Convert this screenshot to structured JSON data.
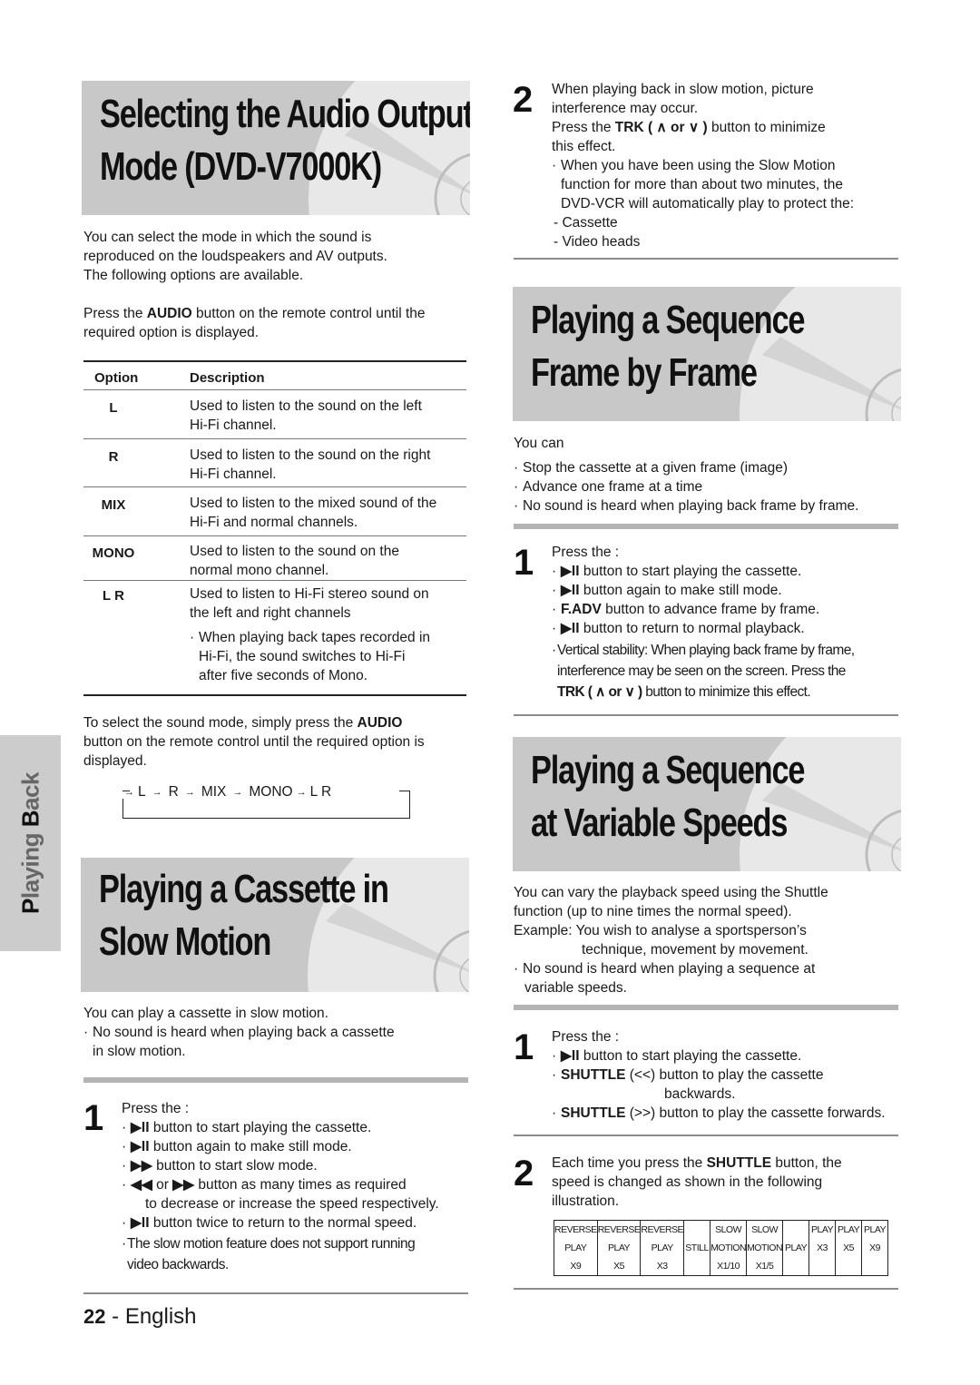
{
  "page": {
    "number": "22",
    "language": "English",
    "side_tab": "Playing Back"
  },
  "audio_output": {
    "title_line1": "Selecting the Audio Output",
    "title_line2": "Mode (DVD-V7000K)",
    "intro_lines": [
      "You can select the mode in which the sound is",
      "reproduced on the loudspeakers and AV outputs.",
      "The following options are available."
    ],
    "press_pre": "Press the ",
    "press_bold": "AUDIO",
    "press_post": " button on the remote control until the",
    "press_line2": "required option is displayed.",
    "table": {
      "header_option": "Option",
      "header_description": "Description",
      "rows": [
        {
          "option": "L",
          "desc": [
            "Used to listen to the sound on the left",
            "Hi-Fi channel."
          ]
        },
        {
          "option": "R",
          "desc": [
            "Used to listen to the sound on the right",
            "Hi-Fi channel."
          ]
        },
        {
          "option": "MIX",
          "desc": [
            "Used to listen to the mixed sound of the",
            "Hi-Fi and normal channels."
          ]
        },
        {
          "option": "MONO",
          "desc": [
            "Used to listen to the sound on the",
            "normal mono channel."
          ]
        },
        {
          "option": "L R",
          "desc": [
            "Used to listen to Hi-Fi stereo sound on",
            "the left and right channels"
          ],
          "note": [
            "When playing back tapes recorded in",
            "Hi-Fi, the sound switches to Hi-Fi",
            "after five seconds of Mono."
          ]
        }
      ]
    },
    "select_pre": "To select the sound mode, simply press the ",
    "select_bold": "AUDIO",
    "select_line2": "button on the remote control until the required option is",
    "select_line3": "displayed.",
    "cycle": [
      "L",
      "R",
      "MIX",
      "MONO",
      "L R"
    ],
    "cycle_arrow": "→"
  },
  "slow_motion": {
    "title_line1": "Playing a Cassette in",
    "title_line2": "Slow Motion",
    "intro": "You can play a cassette in slow motion.",
    "note_line1": "No sound is heard when playing back a cassette",
    "note_line2": "in slow motion.",
    "step1": {
      "number": "1",
      "lead": "Press the :",
      "items": [
        {
          "icon": "▶II",
          "text": " button to start playing the cassette."
        },
        {
          "icon": "▶II",
          "text": " button again to make still mode."
        },
        {
          "icon": "▶▶",
          "text": " button to start slow mode."
        },
        {
          "icon": "◀◀",
          "mid": " or ",
          "icon2": "▶▶",
          "text": " button as many times as required"
        },
        {
          "text": "to decrease or increase the speed respectively."
        },
        {
          "icon": "▶II",
          "text": " button twice to return to the normal speed."
        }
      ],
      "note_line1": "The slow motion feature does not support running",
      "note_line2": "video backwards."
    },
    "step2": {
      "number": "2",
      "line1": "When playing back in slow motion, picture",
      "line2": "interference may occur.",
      "press_pre": "Press the ",
      "press_bold": "TRK ( ∧  or  ∨ )",
      "press_post": " button to minimize",
      "line4": "this effect.",
      "note": [
        "When you have been using the Slow Motion",
        "function for more than about two minutes, the",
        "DVD-VCR will automatically play to protect the:"
      ],
      "protect": [
        "- Cassette",
        "- Video heads"
      ]
    }
  },
  "frame_by_frame": {
    "title_line1": "Playing a Sequence",
    "title_line2": "Frame by Frame",
    "intro": "You can",
    "bullets": [
      "Stop the cassette at a given frame (image)",
      "Advance one frame at a time",
      "No sound is heard when playing back frame by frame."
    ],
    "step1": {
      "number": "1",
      "lead": "Press the :",
      "items": [
        {
          "icon": "▶II",
          "text": " button to start playing the cassette."
        },
        {
          "icon": "▶II",
          "text": " button again to make still mode."
        },
        {
          "icon": "F.ADV",
          "text": " button to advance frame by frame."
        },
        {
          "icon": "▶II",
          "text": " button to return to normal playback."
        }
      ],
      "note": [
        "Vertical stability: When playing back frame by frame,",
        "interference may be seen on the screen. Press the"
      ],
      "note_bold": "TRK ( ∧  or  ∨ )",
      "note_post": " button to minimize this effect."
    }
  },
  "variable_speeds": {
    "title_line1": "Playing a Sequence",
    "title_line2": "at Variable Speeds",
    "intro": [
      "You can vary the playback speed using the Shuttle",
      "function (up to nine times the normal speed).",
      "Example: You wish to analyse a sportsperson’s",
      "technique, movement by movement."
    ],
    "note_line1": "No sound is heard when playing a sequence at",
    "note_line2": "variable speeds.",
    "step1": {
      "number": "1",
      "lead": "Press the :",
      "play_icon": "▶II",
      "play_text": " button to start playing the cassette.",
      "shuttle_back_bold": "SHUTTLE",
      "shuttle_back_text": " (<<) button to play the cassette",
      "shuttle_back_line2": "backwards.",
      "shuttle_fwd_bold": "SHUTTLE",
      "shuttle_fwd_text": " (>>) button to play the cassette forwards."
    },
    "step2": {
      "number": "2",
      "pre": "Each time you press the ",
      "bold": "SHUTTLE",
      "post": " button, the",
      "line2": "speed is changed as shown in the following",
      "line3": "illustration."
    },
    "speed_table": [
      [
        "REVERSE",
        "PLAY",
        "X9"
      ],
      [
        "REVERSE",
        "PLAY",
        "X5"
      ],
      [
        "REVERSE",
        "PLAY",
        "X3"
      ],
      [
        "",
        "STILL",
        ""
      ],
      [
        "SLOW",
        "MOTION",
        "X1/10"
      ],
      [
        "SLOW",
        "MOTION",
        "X1/5"
      ],
      [
        "",
        "PLAY",
        ""
      ],
      [
        "PLAY",
        "X3",
        ""
      ],
      [
        "PLAY",
        "X5",
        ""
      ],
      [
        "PLAY",
        "X9",
        ""
      ]
    ]
  }
}
